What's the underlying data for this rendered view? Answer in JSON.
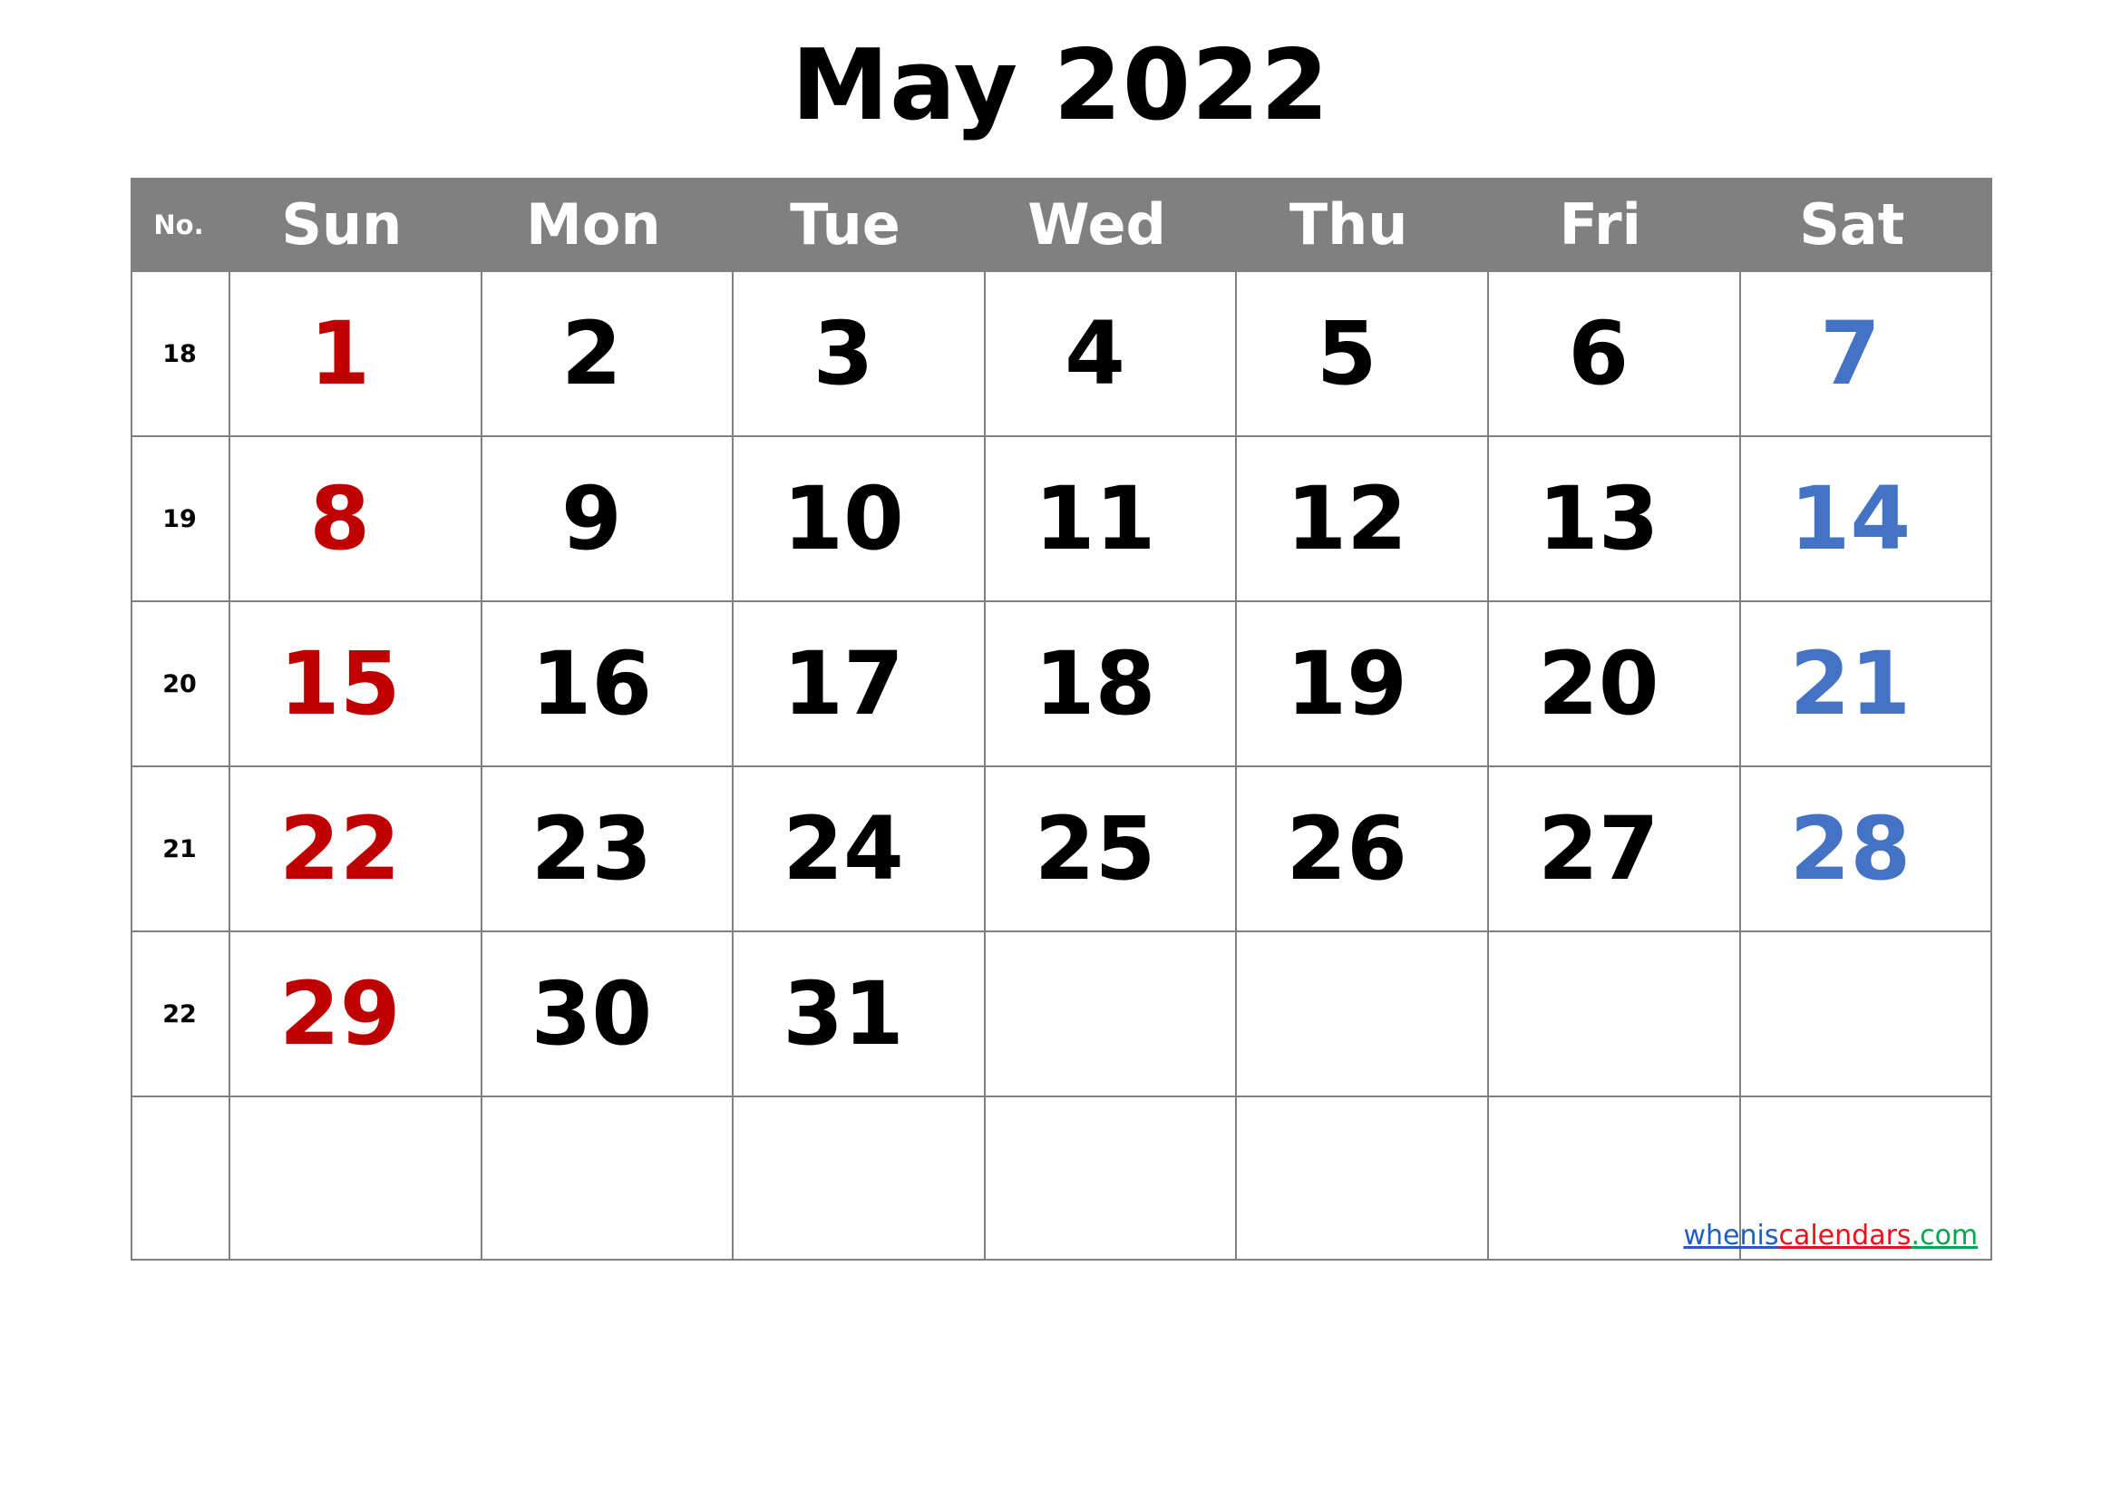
{
  "title": "May 2022",
  "colors": {
    "header_bg": "#808080",
    "header_text": "#ffffff",
    "border": "#808080",
    "sunday": "#C00000",
    "saturday": "#4472C4",
    "weekday": "#000000"
  },
  "header": {
    "week_no_label": "No.",
    "days": [
      "Sun",
      "Mon",
      "Tue",
      "Wed",
      "Thu",
      "Fri",
      "Sat"
    ]
  },
  "weeks": [
    {
      "no": "18",
      "days": [
        "1",
        "2",
        "3",
        "4",
        "5",
        "6",
        "7"
      ]
    },
    {
      "no": "19",
      "days": [
        "8",
        "9",
        "10",
        "11",
        "12",
        "13",
        "14"
      ]
    },
    {
      "no": "20",
      "days": [
        "15",
        "16",
        "17",
        "18",
        "19",
        "20",
        "21"
      ]
    },
    {
      "no": "21",
      "days": [
        "22",
        "23",
        "24",
        "25",
        "26",
        "27",
        "28"
      ]
    },
    {
      "no": "22",
      "days": [
        "29",
        "30",
        "31",
        "",
        "",
        "",
        ""
      ]
    },
    {
      "no": "",
      "days": [
        "",
        "",
        "",
        "",
        "",
        "",
        ""
      ]
    }
  ],
  "watermark": {
    "part1": "whenis",
    "part2": "calendars",
    "part3": ".com"
  }
}
